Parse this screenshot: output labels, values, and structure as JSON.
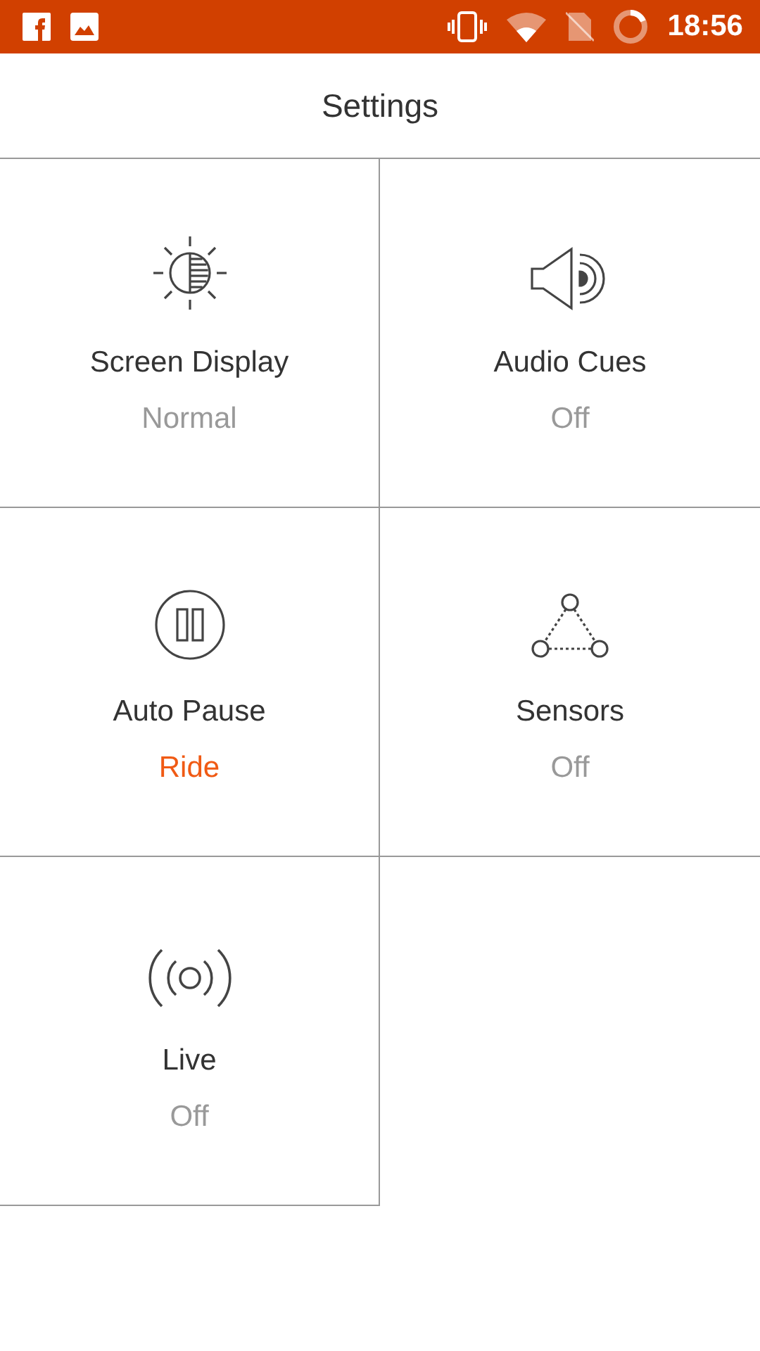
{
  "status_bar": {
    "time": "18:56"
  },
  "header": {
    "title": "Settings"
  },
  "tiles": [
    {
      "kind": "display",
      "label": "Screen Display",
      "value": "Normal",
      "active": false
    },
    {
      "kind": "audio",
      "label": "Audio Cues",
      "value": "Off",
      "active": false
    },
    {
      "kind": "pause",
      "label": "Auto Pause",
      "value": "Ride",
      "active": true
    },
    {
      "kind": "sensors",
      "label": "Sensors",
      "value": "Off",
      "active": false
    },
    {
      "kind": "live",
      "label": "Live",
      "value": "Off",
      "active": false
    }
  ]
}
